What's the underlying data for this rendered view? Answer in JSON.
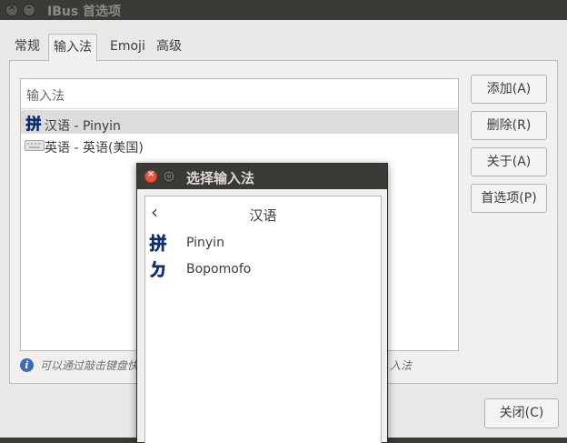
{
  "window": {
    "title": "IBus 首选项",
    "close_glyph": "×",
    "min_glyph": "–"
  },
  "tabs": [
    {
      "label": "常规"
    },
    {
      "label": "输入法"
    },
    {
      "label": "Emoji"
    },
    {
      "label": "高级"
    }
  ],
  "active_tab": "输入法",
  "input_list": {
    "header": "输入法",
    "items": [
      {
        "label": "汉语 - Pinyin",
        "icon": "pinyin-icon",
        "selected": true
      },
      {
        "label": "英语 - 英语(美国)",
        "icon": "keyboard-icon",
        "selected": false
      }
    ]
  },
  "buttons": {
    "add": "添加(A)",
    "remove": "删除(R)",
    "about": "关于(A)",
    "prefs": "首选项(P)",
    "close": "关闭(C)"
  },
  "hint": {
    "icon_glyph": "i",
    "text_visible": "可以通过敲击键盘快",
    "text_tail": "入法"
  },
  "dialog": {
    "title": "选择输入法",
    "close_glyph": "×",
    "back_glyph": "‹",
    "group": "汉语",
    "items": [
      {
        "label": "Pinyin",
        "icon": "pinyin-icon"
      },
      {
        "label": "Bopomofo",
        "icon": "bopomofo-icon"
      }
    ]
  },
  "colors": {
    "titlebar": "#3b3a36",
    "window_bg": "#e8e8e7",
    "close_orange": "#e9573e",
    "ime_blue": "#3b6bb3"
  }
}
